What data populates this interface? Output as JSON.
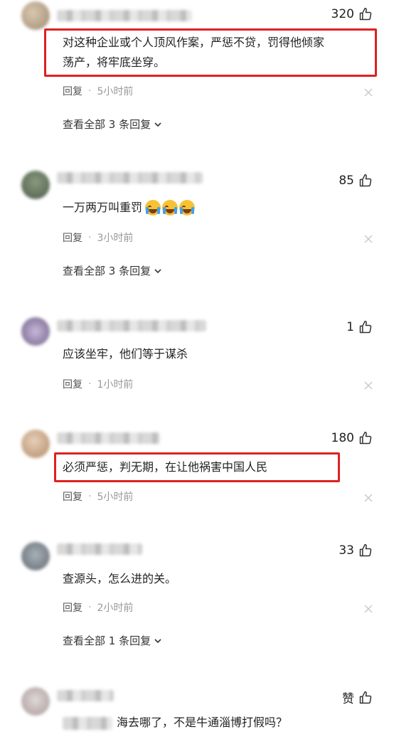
{
  "comments": [
    {
      "likes": "320",
      "text": "对这种企业或个人顶风作案，严惩不贷，罚得他倾家\n荡产，将牢底坐穿。",
      "reply": "回复",
      "dot": "·",
      "time": "5小时前",
      "view_all": "查看全部 3 条回复"
    },
    {
      "likes": "85",
      "text": "一万两万叫重罚",
      "reply": "回复",
      "dot": "·",
      "time": "3小时前",
      "view_all": "查看全部 3 条回复"
    },
    {
      "likes": "1",
      "text": "应该坐牢，他们等于谋杀",
      "reply": "回复",
      "dot": "·",
      "time": "1小时前"
    },
    {
      "likes": "180",
      "text": "必须严惩，判无期，在让他祸害中国人民",
      "reply": "回复",
      "dot": "·",
      "time": "5小时前"
    },
    {
      "likes": "33",
      "text": "查源头，怎么进的关。",
      "reply": "回复",
      "dot": "·",
      "time": "2小时前",
      "view_all": "查看全部 1 条回复"
    },
    {
      "likes": "赞",
      "text": "海去哪了，不是牛通淄博打假吗？"
    }
  ],
  "colors": {
    "highlight": "#e02020",
    "text": "#222222",
    "meta": "#999999"
  },
  "icons": {
    "like": "thumbs-up-icon",
    "dismiss": "close-icon",
    "expand": "chevron-down-icon"
  }
}
